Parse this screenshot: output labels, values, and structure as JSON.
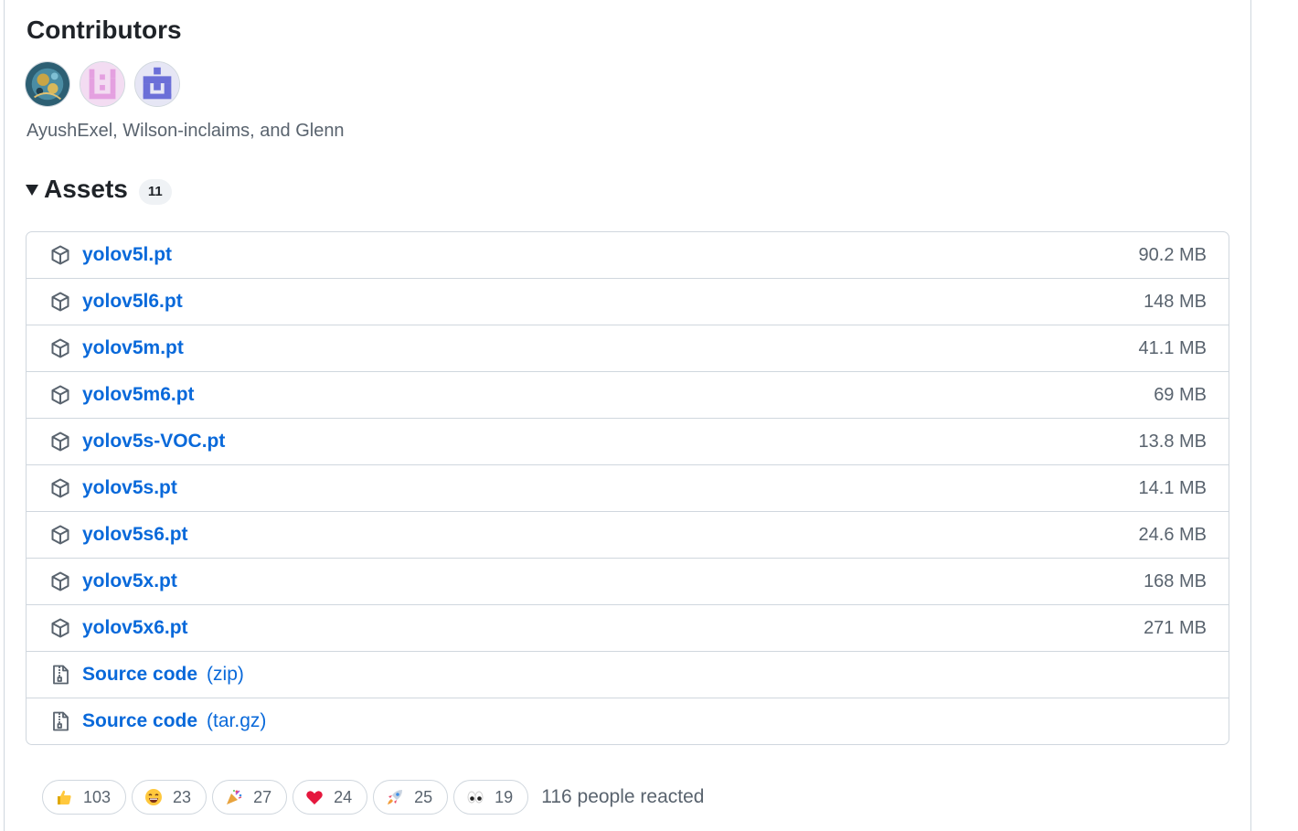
{
  "contributors": {
    "title": "Contributors",
    "names": "AyushExel, Wilson-inclaims, and Glenn",
    "avatars": [
      {
        "name": "avatar-ayushexel",
        "colors": [
          "#2d5f73",
          "#c9a545"
        ]
      },
      {
        "name": "avatar-wilson-inclaims",
        "colors": [
          "#e4a0e0",
          "#f3dcf2"
        ]
      },
      {
        "name": "avatar-glenn",
        "colors": [
          "#6b6fd8",
          "#e6e6f5"
        ]
      }
    ]
  },
  "assets": {
    "title": "Assets",
    "count": "11",
    "items": [
      {
        "name": "yolov5l.pt",
        "size": "90.2 MB",
        "icon": "package-icon"
      },
      {
        "name": "yolov5l6.pt",
        "size": "148 MB",
        "icon": "package-icon"
      },
      {
        "name": "yolov5m.pt",
        "size": "41.1 MB",
        "icon": "package-icon"
      },
      {
        "name": "yolov5m6.pt",
        "size": "69 MB",
        "icon": "package-icon"
      },
      {
        "name": "yolov5s-VOC.pt",
        "size": "13.8 MB",
        "icon": "package-icon"
      },
      {
        "name": "yolov5s.pt",
        "size": "14.1 MB",
        "icon": "package-icon"
      },
      {
        "name": "yolov5s6.pt",
        "size": "24.6 MB",
        "icon": "package-icon"
      },
      {
        "name": "yolov5x.pt",
        "size": "168 MB",
        "icon": "package-icon"
      },
      {
        "name": "yolov5x6.pt",
        "size": "271 MB",
        "icon": "package-icon"
      },
      {
        "name": "Source code",
        "ext": "(zip)",
        "size": "",
        "icon": "file-zip-icon"
      },
      {
        "name": "Source code",
        "ext": "(tar.gz)",
        "size": "",
        "icon": "file-zip-icon"
      }
    ]
  },
  "reactions": {
    "items": [
      {
        "emoji": "thumbs-up-icon",
        "count": "103"
      },
      {
        "emoji": "laugh-icon",
        "count": "23"
      },
      {
        "emoji": "hooray-icon",
        "count": "27"
      },
      {
        "emoji": "heart-icon",
        "count": "24"
      },
      {
        "emoji": "rocket-icon",
        "count": "25"
      },
      {
        "emoji": "eyes-icon",
        "count": "19"
      }
    ],
    "summary": "116 people reacted"
  },
  "colors": {
    "link": "#0969da",
    "muted": "#59636e",
    "border": "#d0d7de"
  }
}
